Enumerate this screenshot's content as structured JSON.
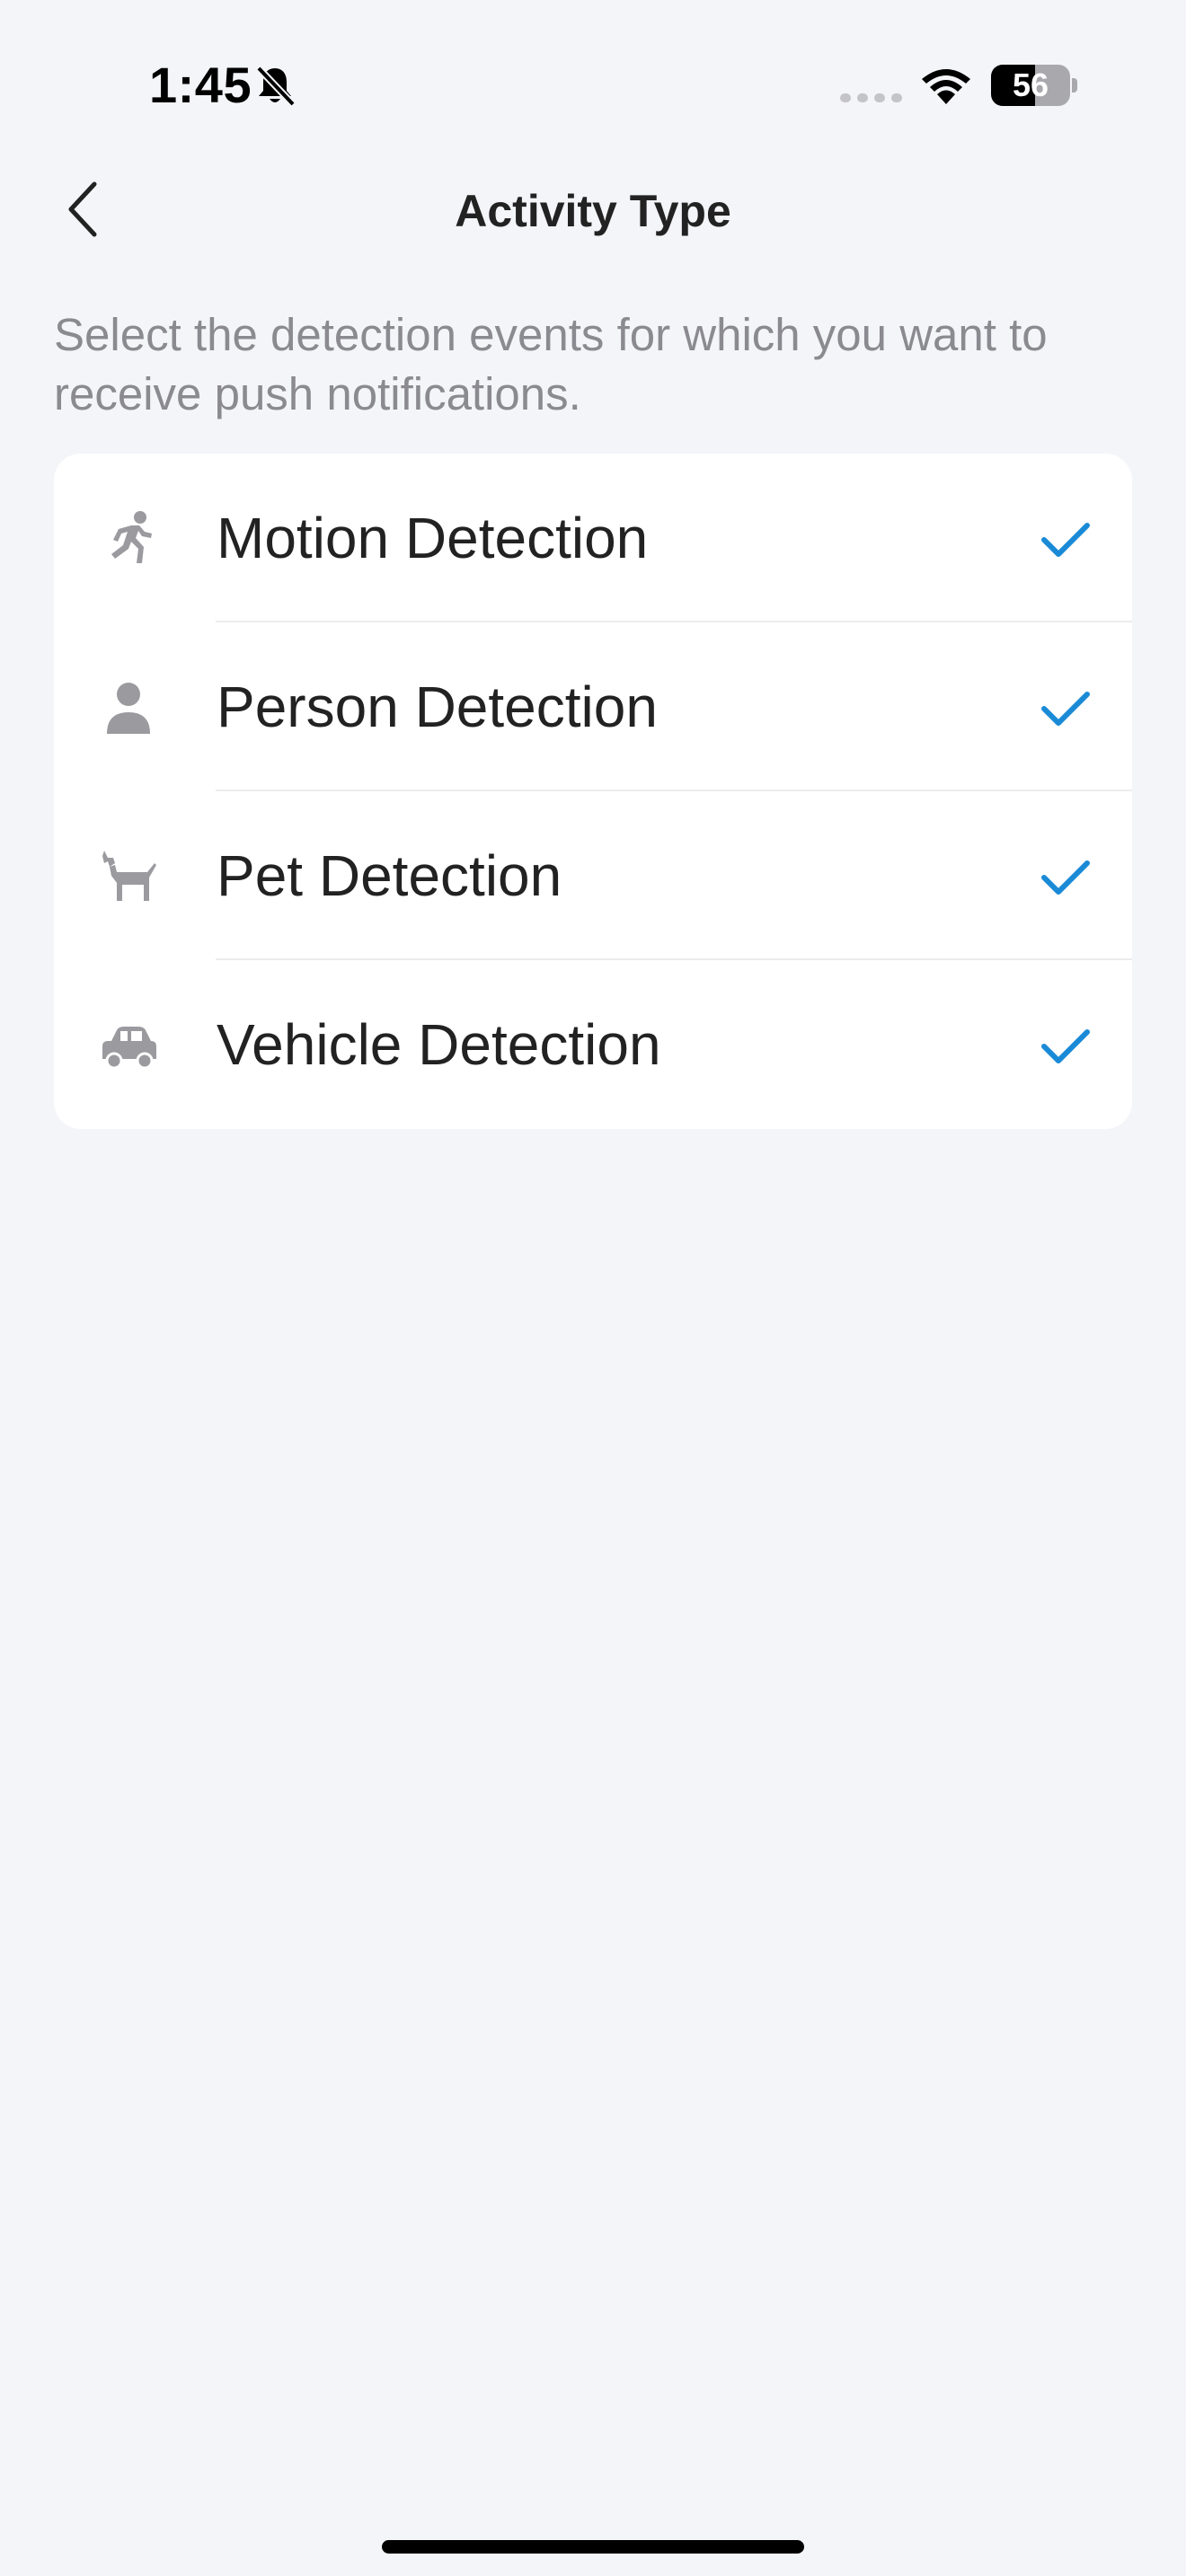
{
  "status_bar": {
    "time": "1:45",
    "battery_level": "56",
    "battery_percent": 56,
    "icons": [
      "bell-slash-icon",
      "cellular-signal-icon",
      "wifi-icon",
      "battery-icon"
    ]
  },
  "header": {
    "back_icon": "chevron-left-icon",
    "title": "Activity Type"
  },
  "description": "Select the detection events for which you want to receive push notifications.",
  "options": [
    {
      "icon": "running-person-icon",
      "label": "Motion Detection",
      "checked": true
    },
    {
      "icon": "person-icon",
      "label": "Person Detection",
      "checked": true
    },
    {
      "icon": "dog-icon",
      "label": "Pet Detection",
      "checked": true
    },
    {
      "icon": "car-icon",
      "label": "Vehicle Detection",
      "checked": true
    }
  ],
  "colors": {
    "background": "#f4f5f9",
    "card": "#ffffff",
    "accent_check": "#1a8ad6",
    "icon_gray": "#9a9a9f",
    "description_gray": "#8a8a90",
    "title": "#222222"
  }
}
